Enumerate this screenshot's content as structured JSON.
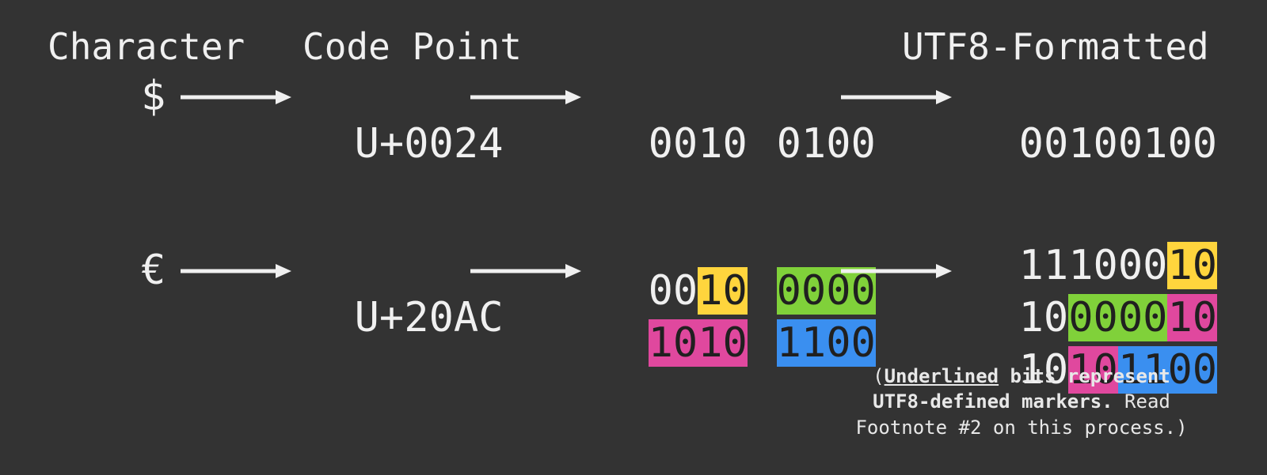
{
  "headers": {
    "character": "Character",
    "codePoint": "Code Point",
    "utf8": "UTF8-Formatted"
  },
  "row1": {
    "char": "$",
    "prefix": "U+",
    "cp_a": "00",
    "cp_b": "2",
    "cp_c": "4",
    "nib_a_plain": "00",
    "nib_a_orange": "10",
    "nib_b": "0100",
    "utf8": {
      "lead0": "0",
      "afterLead": "0",
      "orange": "10",
      "teal": "0100"
    }
  },
  "row2": {
    "char": "€",
    "prefix": "U+",
    "cp": {
      "a": "2",
      "b": "0",
      "c": "A",
      "d": "C"
    },
    "nib": {
      "tl_plain": "00",
      "tl_yellow": "10",
      "tr_green": "0000",
      "bl_pink": "1010",
      "br_blue": "1100"
    },
    "utf8": {
      "l1_lead": "1110",
      "l1_plain": "00",
      "l1_yellow": "10",
      "l2_lead": "10",
      "l2_green": "0000",
      "l2_pink": "10",
      "l3_lead": "10",
      "l3_pink": "10",
      "l3_blue": "1100"
    }
  },
  "note": {
    "open": "(",
    "ul": "Underlined",
    "bold1": " bits represent",
    "bold2": "UTF8-defined markers.",
    "tail": " Read",
    "line3": "Footnote #2 on this process.)"
  },
  "colors": {
    "orange": "#f05a3f",
    "teal": "#39c9b0",
    "yellow": "#ffd53d",
    "green": "#80d13a",
    "pink": "#e0489e",
    "blue": "#3a8ff0"
  }
}
